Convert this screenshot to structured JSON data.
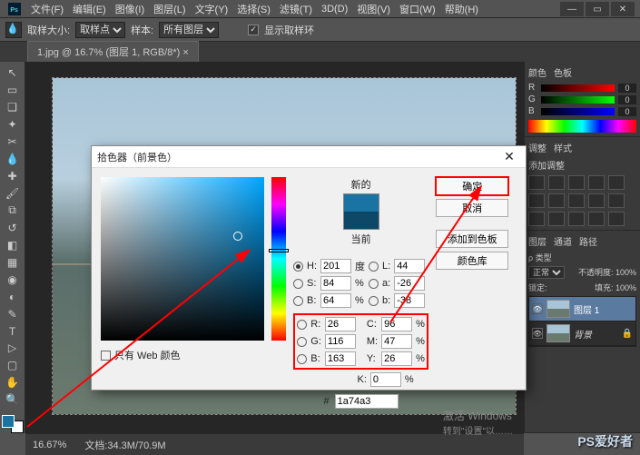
{
  "menu": {
    "items": [
      "文件(F)",
      "编辑(E)",
      "图像(I)",
      "图层(L)",
      "文字(Y)",
      "选择(S)",
      "滤镜(T)",
      "3D(D)",
      "视图(V)",
      "窗口(W)",
      "帮助(H)"
    ]
  },
  "options": {
    "sample_size_label": "取样大小:",
    "sample_size_value": "取样点",
    "sample_label": "样本:",
    "sample_value": "所有图层",
    "show_ring": "显示取样环"
  },
  "doc_tab": "1.jpg @ 16.7% (图层 1, RGB/8*) ×",
  "color_panel": {
    "tabs": [
      "颜色",
      "色板"
    ],
    "r": "0",
    "g": "0",
    "b": "0"
  },
  "adjust_panel": {
    "tabs": [
      "调整",
      "样式"
    ],
    "label": "添加调整"
  },
  "layers_panel": {
    "tabs": [
      "图层",
      "通道",
      "路径"
    ],
    "kind_label": "ρ 类型",
    "mode": "正常",
    "opacity_label": "不透明度:",
    "opacity_value": "100%",
    "lock_label": "锁定:",
    "fill_label": "填充:",
    "fill_value": "100%",
    "layers": [
      {
        "name": "图层 1",
        "selected": true
      },
      {
        "name": "背景",
        "locked": true
      }
    ]
  },
  "status": {
    "zoom": "16.67%",
    "docinfo": "文档:34.3M/70.9M"
  },
  "activate": {
    "line1": "激活 Windows",
    "line2": "转到\"设置\"以……"
  },
  "watermark": "PS爱好者",
  "picker": {
    "title": "拾色器（前景色）",
    "new_label": "新的",
    "current_label": "当前",
    "ok": "确定",
    "cancel": "取消",
    "add_swatch": "添加到色板",
    "libraries": "颜色库",
    "H": "201",
    "H_unit": "度",
    "S": "84",
    "S_unit": "%",
    "Bval": "64",
    "B_unit": "%",
    "R": "26",
    "G": "116",
    "B": "163",
    "L": "44",
    "a": "-26",
    "b": "-38",
    "C": "96",
    "M": "47",
    "Y": "26",
    "K": "0",
    "C_unit": "%",
    "M_unit": "%",
    "Y_unit": "%",
    "K_unit": "%",
    "hex_label": "#",
    "hex": "1a74a3",
    "web_only": "只有 Web 颜色"
  }
}
